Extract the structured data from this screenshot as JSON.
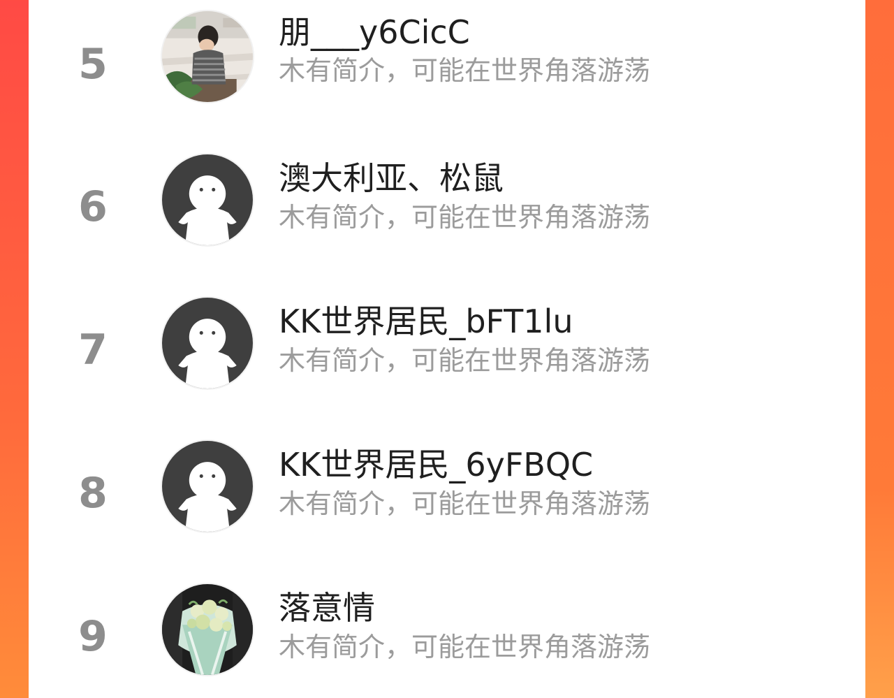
{
  "colors": {
    "accent": "#ff5a3f",
    "card": "#ffffff",
    "rank_text": "#8d8d8d",
    "name_text": "#1f1f1f",
    "bio_text": "#9b9b9b"
  },
  "ranking": {
    "items": [
      {
        "rank": "5",
        "name": "朋___y6CicC",
        "bio": "木有简介，可能在世界角落游荡",
        "avatar": "photo-child-icon"
      },
      {
        "rank": "6",
        "name": "澳大利亚、松鼠",
        "bio": "木有简介，可能在世界角落游荡",
        "avatar": "default-ghost-avatar-icon"
      },
      {
        "rank": "7",
        "name": "KK世界居民_bFT1lu",
        "bio": "木有简介，可能在世界角落游荡",
        "avatar": "default-ghost-avatar-icon"
      },
      {
        "rank": "8",
        "name": "KK世界居民_6yFBQC",
        "bio": "木有简介，可能在世界角落游荡",
        "avatar": "default-ghost-avatar-icon"
      },
      {
        "rank": "9",
        "name": "落意情",
        "bio": "木有简介，可能在世界角落游荡",
        "avatar": "photo-bouquet-icon"
      }
    ]
  }
}
